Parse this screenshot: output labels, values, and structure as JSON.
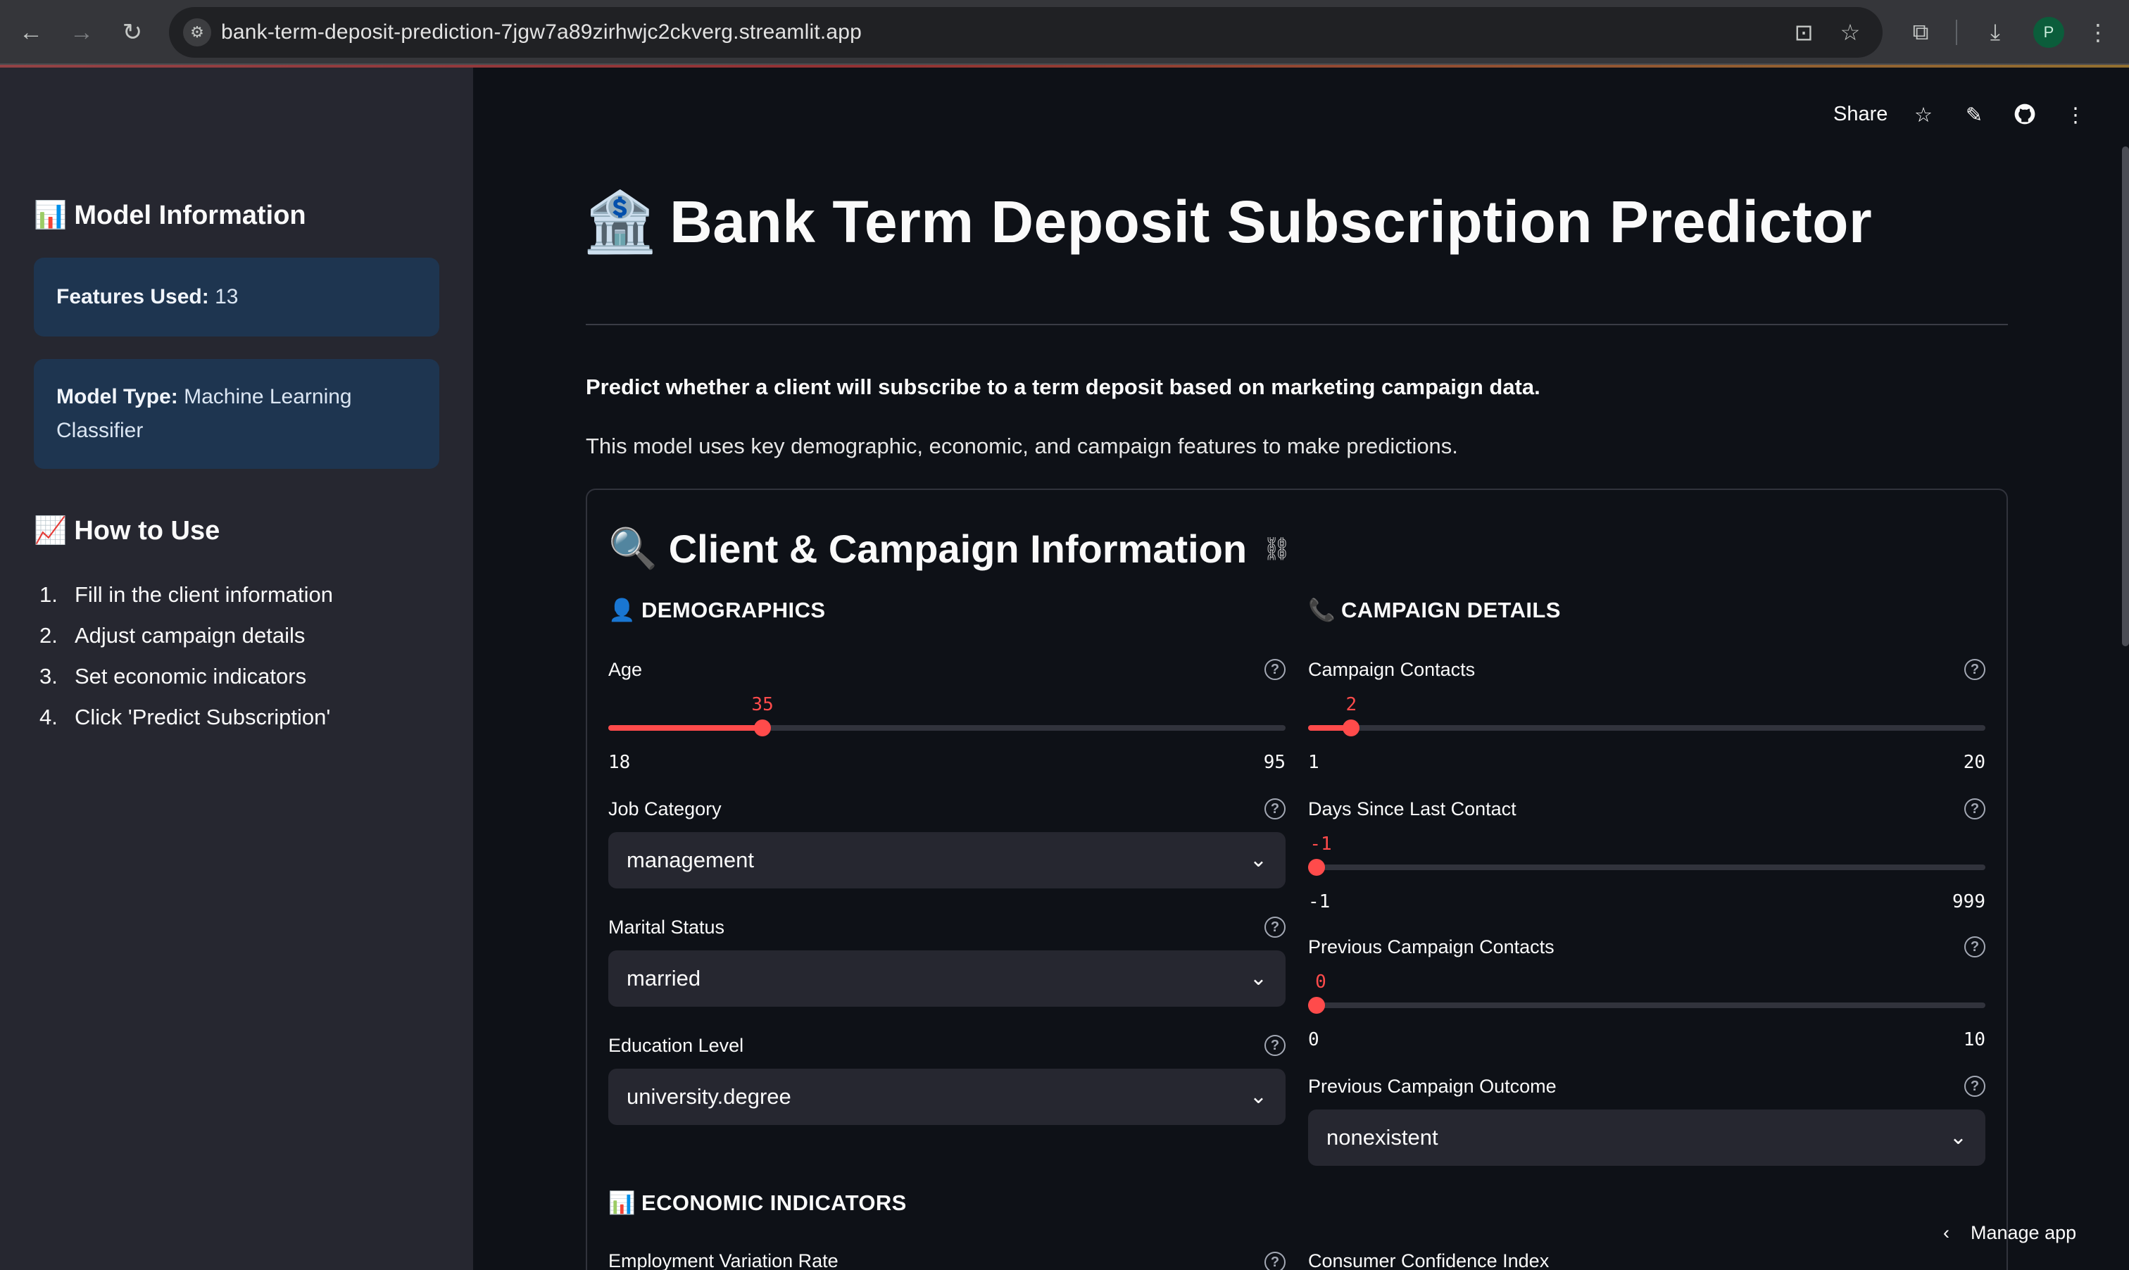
{
  "browser": {
    "url": "bank-term-deposit-prediction-7jgw7a89zirhwjc2ckverg.streamlit.app",
    "profile_initial": "P"
  },
  "sidebar": {
    "model_info_icon": "📊",
    "model_info_heading": "Model Information",
    "features_label": "Features Used:",
    "features_value": "13",
    "model_type_label": "Model Type:",
    "model_type_value": "Machine Learning Classifier",
    "how_to_icon": "📈",
    "how_to_heading": "How to Use",
    "steps": [
      {
        "num": "1.",
        "text": "Fill in the client information"
      },
      {
        "num": "2.",
        "text": "Adjust campaign details"
      },
      {
        "num": "3.",
        "text": "Set economic indicators"
      },
      {
        "num": "4.",
        "text": "Click 'Predict Subscription'"
      }
    ]
  },
  "topbar": {
    "share_label": "Share"
  },
  "main": {
    "title_icon": "🏦",
    "title": "Bank Term Deposit Subscription Predictor",
    "intro_bold": "Predict whether a client will subscribe to a term deposit based on marketing campaign data.",
    "intro": "This model uses key demographic, economic, and campaign features to make predictions.",
    "form_icon": "🔍",
    "form_title": "Client & Campaign Information",
    "demographics": {
      "icon": "👤",
      "heading": "DEMOGRAPHICS",
      "age": {
        "label": "Age",
        "value": 35,
        "min": 18,
        "max": 95
      },
      "job": {
        "label": "Job Category",
        "value": "management"
      },
      "marital": {
        "label": "Marital Status",
        "value": "married"
      },
      "education": {
        "label": "Education Level",
        "value": "university.degree"
      }
    },
    "campaign": {
      "icon": "📞",
      "heading": "CAMPAIGN DETAILS",
      "contacts": {
        "label": "Campaign Contacts",
        "value": 2,
        "min": 1,
        "max": 20
      },
      "pdays": {
        "label": "Days Since Last Contact",
        "value": -1,
        "min": -1,
        "max": 999
      },
      "previous": {
        "label": "Previous Campaign Contacts",
        "value": 0,
        "min": 0,
        "max": 10
      },
      "poutcome": {
        "label": "Previous Campaign Outcome",
        "value": "nonexistent"
      }
    },
    "economic": {
      "icon": "📊",
      "heading": "ECONOMIC INDICATORS",
      "emp_var_label": "Employment Variation Rate",
      "cons_conf_label": "Consumer Confidence Index"
    }
  },
  "footer": {
    "manage_label": "Manage app"
  },
  "colors": {
    "accent": "#ff4b4b",
    "sidebar_bg": "#262730",
    "main_bg": "#0e1117",
    "info_card": "#1e3550"
  }
}
